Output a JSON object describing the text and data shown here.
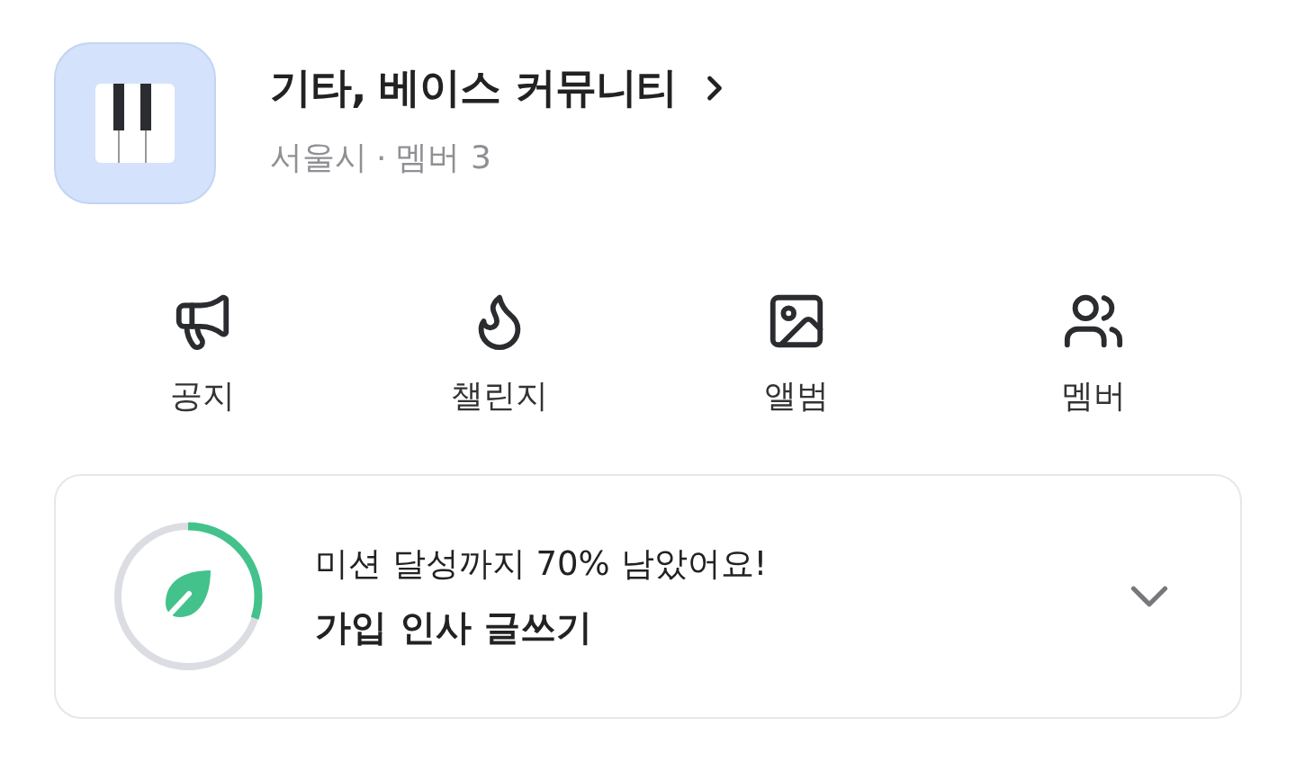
{
  "community": {
    "title": "기타, 베이스 커뮤니티",
    "location": "서울시",
    "separator": "·",
    "members": "멤버 3"
  },
  "menu": [
    {
      "kind": "notice",
      "label": "공지"
    },
    {
      "kind": "challenge",
      "label": "챌린지"
    },
    {
      "kind": "album",
      "label": "앨범"
    },
    {
      "kind": "members",
      "label": "멤버"
    }
  ],
  "mission": {
    "level": 0.3,
    "status": "미션 달성까지 70% 남았어요!",
    "task": "가입 인사 글쓰기",
    "expanded": false
  }
}
